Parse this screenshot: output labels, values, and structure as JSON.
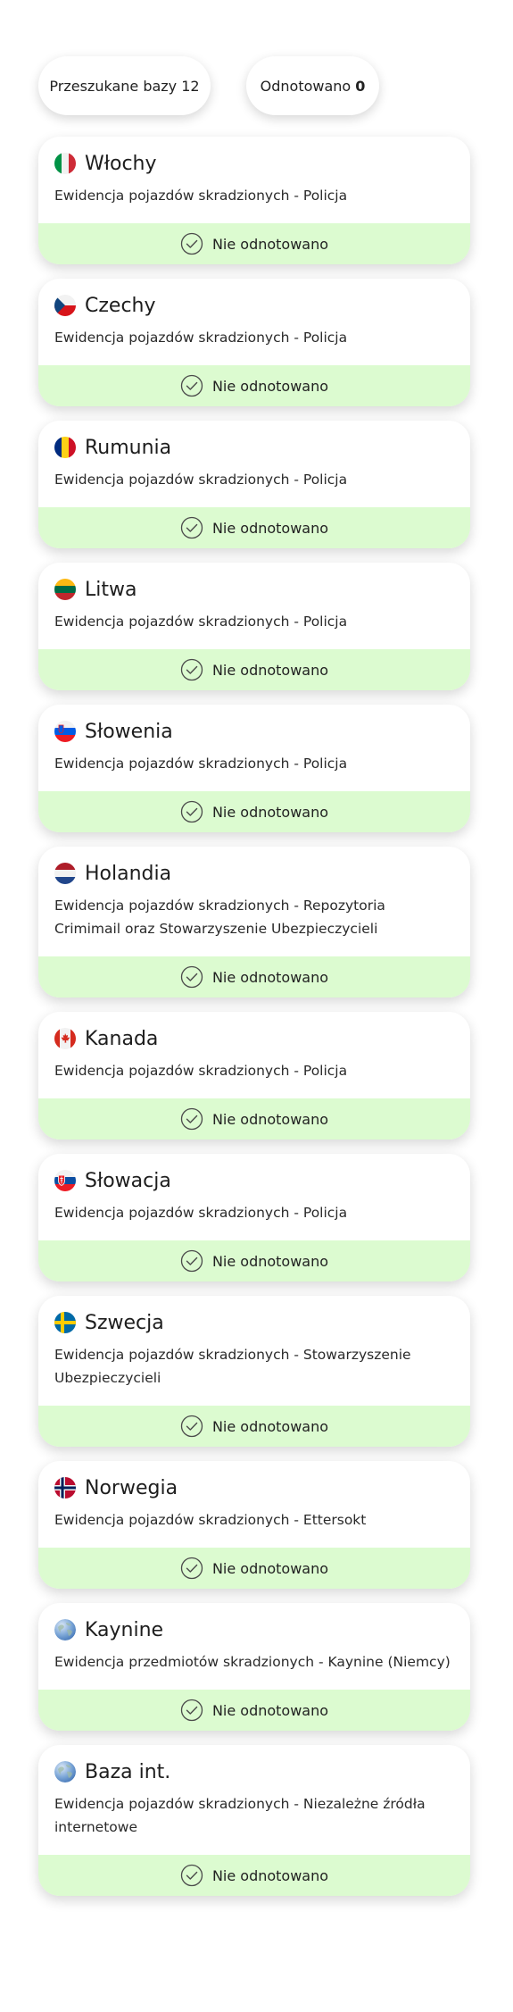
{
  "summary": {
    "searched_label": "Przeszukane bazy",
    "searched_count": "12",
    "found_label": "Odnotowano",
    "found_count": "0"
  },
  "status_text": "Nie odnotowano",
  "colors": {
    "status_bg": "#dcfbd0",
    "check_stroke": "#4a4a4a"
  },
  "databases": [
    {
      "country": "Włochy",
      "flag": "italy-flag-icon",
      "description": "Ewidencja pojazdów skradzionych - Policja",
      "status": "Nie odnotowano"
    },
    {
      "country": "Czechy",
      "flag": "czechia-flag-icon",
      "description": "Ewidencja pojazdów skradzionych - Policja",
      "status": "Nie odnotowano"
    },
    {
      "country": "Rumunia",
      "flag": "romania-flag-icon",
      "description": "Ewidencja pojazdów skradzionych - Policja",
      "status": "Nie odnotowano"
    },
    {
      "country": "Litwa",
      "flag": "lithuania-flag-icon",
      "description": "Ewidencja pojazdów skradzionych - Policja",
      "status": "Nie odnotowano"
    },
    {
      "country": "Słowenia",
      "flag": "slovenia-flag-icon",
      "description": "Ewidencja pojazdów skradzionych - Policja",
      "status": "Nie odnotowano"
    },
    {
      "country": "Holandia",
      "flag": "netherlands-flag-icon",
      "description": "Ewidencja pojazdów skradzionych - Repozytoria Crimimail oraz Stowarzyszenie Ubezpieczycieli",
      "status": "Nie odnotowano"
    },
    {
      "country": "Kanada",
      "flag": "canada-flag-icon",
      "description": "Ewidencja pojazdów skradzionych - Policja",
      "status": "Nie odnotowano"
    },
    {
      "country": "Słowacja",
      "flag": "slovakia-flag-icon",
      "description": "Ewidencja pojazdów skradzionych - Policja",
      "status": "Nie odnotowano"
    },
    {
      "country": "Szwecja",
      "flag": "sweden-flag-icon",
      "description": "Ewidencja pojazdów skradzionych - Stowarzyszenie Ubezpieczycieli",
      "status": "Nie odnotowano"
    },
    {
      "country": "Norwegia",
      "flag": "norway-flag-icon",
      "description": "Ewidencja pojazdów skradzionych - Ettersokt",
      "status": "Nie odnotowano"
    },
    {
      "country": "Kaynine",
      "flag": "globe-icon",
      "description": "Ewidencja przedmiotów skradzionych - Kaynine (Niemcy)",
      "status": "Nie odnotowano"
    },
    {
      "country": "Baza int.",
      "flag": "globe-icon",
      "description": "Ewidencja pojazdów skradzionych - Niezależne źródła internetowe",
      "status": "Nie odnotowano"
    }
  ]
}
